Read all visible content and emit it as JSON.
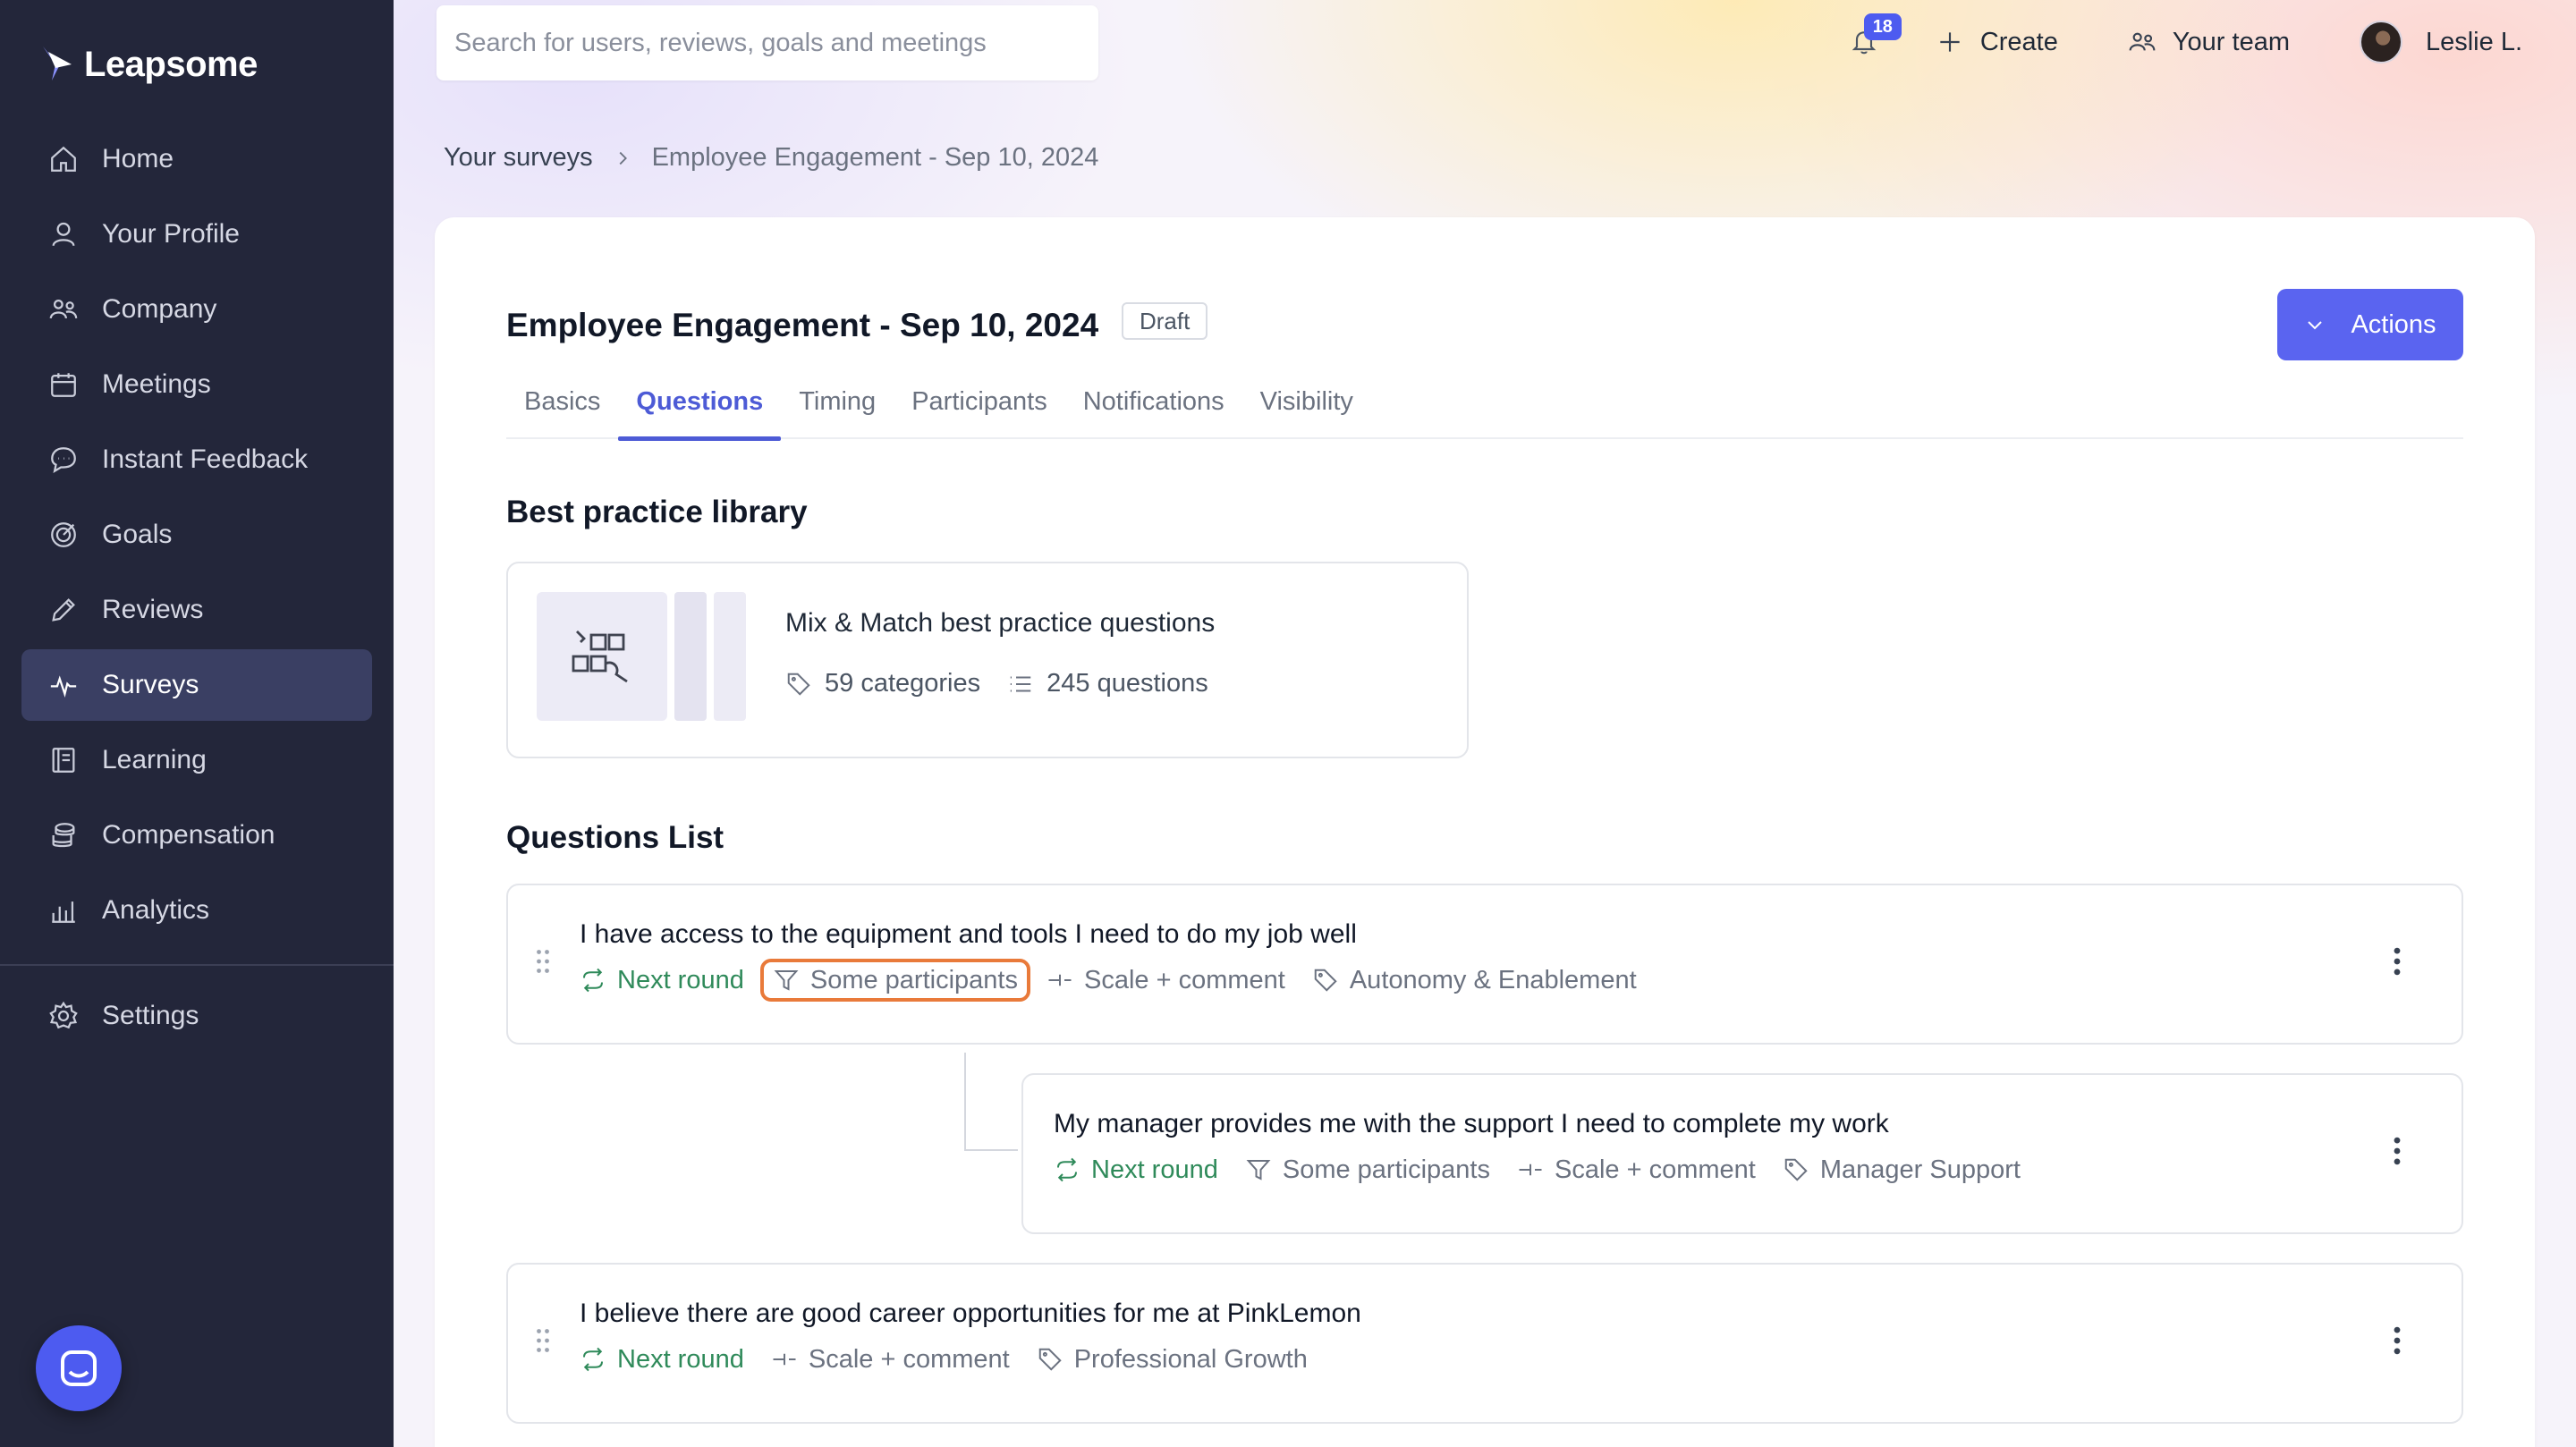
{
  "app": {
    "brand": "Leapsome"
  },
  "sidebar": {
    "items": [
      {
        "label": "Home",
        "icon": "home-icon"
      },
      {
        "label": "Your Profile",
        "icon": "user-icon"
      },
      {
        "label": "Company",
        "icon": "people-icon"
      },
      {
        "label": "Meetings",
        "icon": "calendar-icon"
      },
      {
        "label": "Instant Feedback",
        "icon": "chat-icon"
      },
      {
        "label": "Goals",
        "icon": "target-icon"
      },
      {
        "label": "Reviews",
        "icon": "pencil-icon"
      },
      {
        "label": "Surveys",
        "icon": "pulse-icon",
        "active": true
      },
      {
        "label": "Learning",
        "icon": "book-icon"
      },
      {
        "label": "Compensation",
        "icon": "coins-icon"
      },
      {
        "label": "Analytics",
        "icon": "bar-chart-icon"
      }
    ],
    "settings": {
      "label": "Settings",
      "icon": "gear-icon"
    }
  },
  "topbar": {
    "search_placeholder": "Search for users, reviews, goals and meetings",
    "notifications_count": "18",
    "create_label": "Create",
    "team_label": "Your team",
    "user_name": "Leslie L."
  },
  "breadcrumb": {
    "parent": "Your surveys",
    "current": "Employee Engagement - Sep 10, 2024"
  },
  "survey": {
    "title": "Employee Engagement - Sep 10, 2024",
    "status": "Draft",
    "actions_label": "Actions",
    "tabs": [
      "Basics",
      "Questions",
      "Timing",
      "Participants",
      "Notifications",
      "Visibility"
    ],
    "active_tab": "Questions"
  },
  "library": {
    "section_title": "Best practice library",
    "card_title": "Mix & Match best practice questions",
    "categories": "59 categories",
    "questions": "245 questions"
  },
  "questions_list": {
    "section_title": "Questions List",
    "items": [
      {
        "text": "I have access to the equipment and tools I need to do my job well",
        "round": "Next round",
        "participants": "Some participants",
        "type": "Scale + comment",
        "category": "Autonomy & Enablement"
      },
      {
        "text": "My manager provides me with the support I need to complete my work",
        "round": "Next round",
        "participants": "Some participants",
        "type": "Scale + comment",
        "category": "Manager Support"
      },
      {
        "text": "I believe there are good career opportunities for me at PinkLemon",
        "round": "Next round",
        "type": "Scale + comment",
        "category": "Professional Growth"
      }
    ]
  },
  "colors": {
    "sidebar_bg": "#23263a",
    "accent": "#5a64f0",
    "green": "#2f8a5a",
    "highlight": "#e97a3a"
  }
}
